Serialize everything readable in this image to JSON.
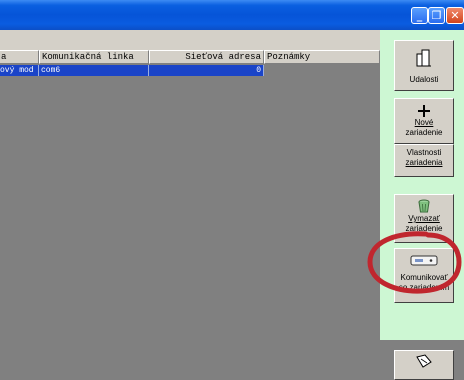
{
  "window": {
    "min_symbol": "_",
    "max_symbol": "❐",
    "close_symbol": "✕"
  },
  "grid": {
    "columns": [
      "a",
      "Komunikačná linka",
      "Sieťová adresa",
      "Poznámky"
    ],
    "rows": [
      {
        "c1": "ový mod",
        "c2": "com6",
        "c3": "0"
      }
    ]
  },
  "panel": {
    "udalosti": "Udalosti",
    "nove_line1": "Nové",
    "nove_line2": "zariadenie",
    "vlastnosti_line1": "Vlastnosti",
    "vlastnosti_line2": "zariadenia",
    "vymazat_line1": "Vymazať",
    "vymazat_line2": "zariadenie",
    "komunikovat_line1": "Komunikovať",
    "komunikovat_line2": "so zariadením"
  },
  "colors": {
    "selection": "#1a44c8",
    "panel_bg": "#cdf7d3",
    "annotation": "#c0262e"
  }
}
